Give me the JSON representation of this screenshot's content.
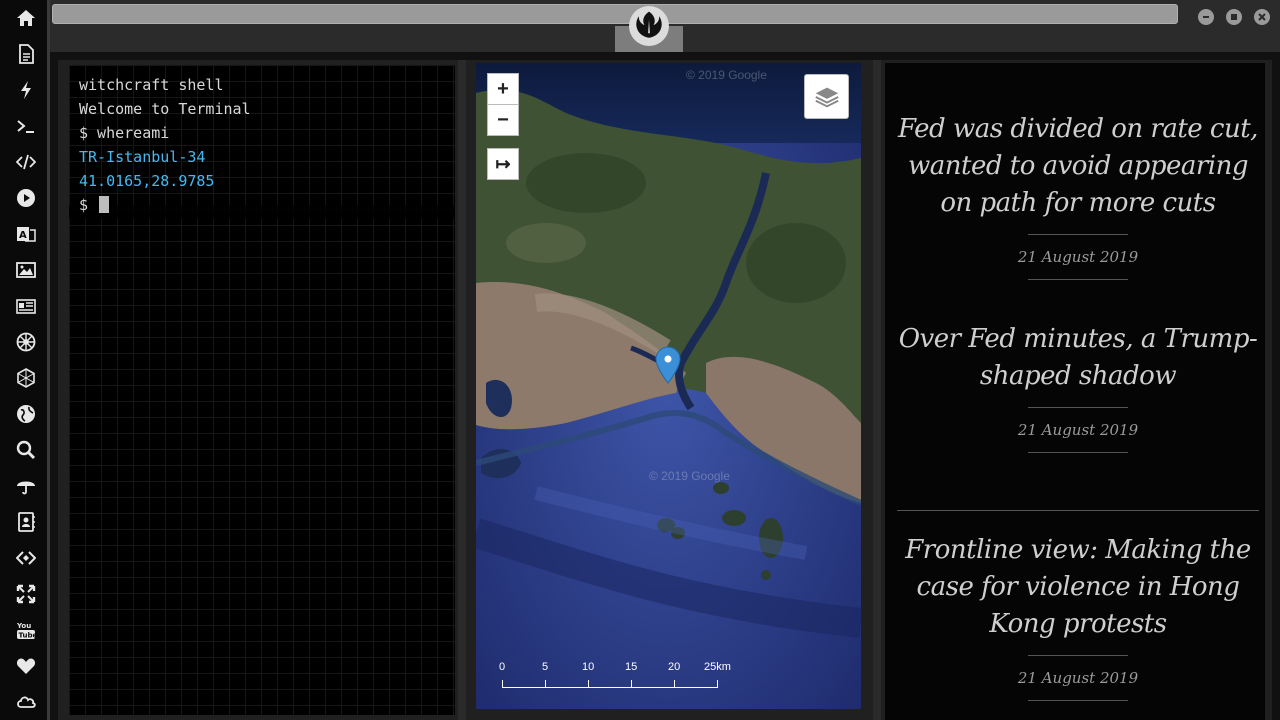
{
  "dock": {
    "items": [
      {
        "name": "home-icon"
      },
      {
        "name": "document-icon"
      },
      {
        "name": "lightning-icon"
      },
      {
        "name": "terminal-icon"
      },
      {
        "name": "code-icon"
      },
      {
        "name": "play-icon"
      },
      {
        "name": "translate-icon"
      },
      {
        "name": "image-icon"
      },
      {
        "name": "newspaper-icon"
      },
      {
        "name": "empire-icon"
      },
      {
        "name": "hexagon-icon"
      },
      {
        "name": "globe-icon"
      },
      {
        "name": "search-icon"
      },
      {
        "name": "umbrella-icon"
      },
      {
        "name": "contacts-icon"
      },
      {
        "name": "diamond-code-icon"
      },
      {
        "name": "fullscreen-icon"
      },
      {
        "name": "youtube-icon"
      },
      {
        "name": "heart-icon"
      },
      {
        "name": "cloud-icon"
      }
    ]
  },
  "window": {
    "logo_icon": "rebel-alliance-icon",
    "controls": [
      "minimize-icon",
      "maximize-icon",
      "close-icon"
    ]
  },
  "terminal": {
    "lines": [
      {
        "text": "witchcraft shell",
        "type": "plain"
      },
      {
        "text": "Welcome to Terminal",
        "type": "plain"
      },
      {
        "text": "$ whereami",
        "type": "command"
      },
      {
        "text": "TR-Istanbul-34",
        "type": "output"
      },
      {
        "text": "41.0165,28.9785",
        "type": "output"
      }
    ],
    "prompt": "$ "
  },
  "map": {
    "zoom_in": "+",
    "zoom_out": "−",
    "locate": "↦",
    "watermark": "© 2019 Google",
    "scale": [
      "0",
      "5",
      "10",
      "15",
      "20",
      "25km"
    ],
    "colors": {
      "water": "#2f3f88",
      "land": "#6b7a5a",
      "pin": "#3a8fd6"
    }
  },
  "news": {
    "articles": [
      {
        "title": "Fed was divided on rate cut, wanted to avoid appearing on path for more cuts",
        "date": "21 August 2019"
      },
      {
        "title": "Over Fed minutes, a Trump-shaped shadow",
        "date": "21 August 2019"
      },
      {
        "title": "Frontline view: Making the case for violence in Hong Kong protests",
        "date": "21 August 2019"
      }
    ]
  }
}
